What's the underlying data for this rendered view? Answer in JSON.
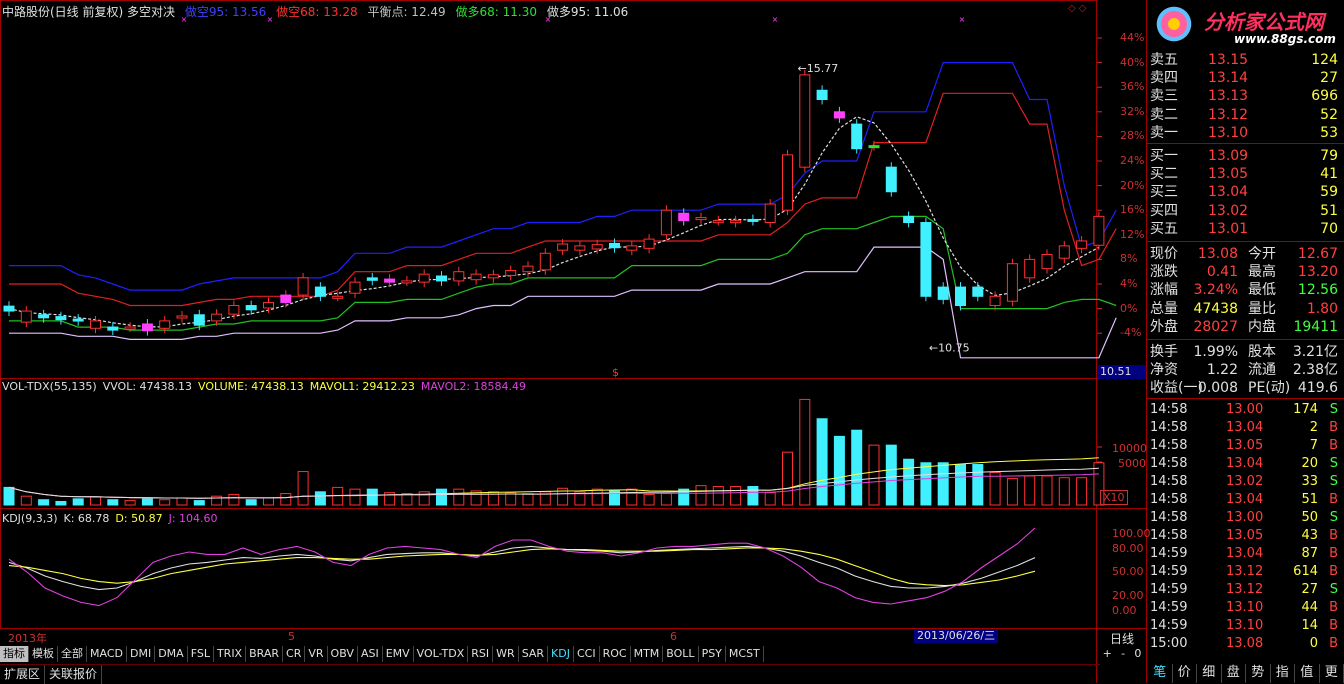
{
  "header": {
    "title": "中路股份(日线 前复权) 多空对决",
    "items": [
      {
        "label": "做空95: 13.56",
        "color": "#4040ff"
      },
      {
        "label": "做空68: 13.28",
        "color": "#ff3030"
      },
      {
        "label": "平衡点: 12.49",
        "color": "#c0c0c0"
      },
      {
        "label": "做多68: 11.30",
        "color": "#30e030"
      },
      {
        "label": "做多95: 11.06",
        "color": "#e0e0e0"
      }
    ]
  },
  "price_axis": [
    "44%",
    "40%",
    "36%",
    "32%",
    "28%",
    "24%",
    "20%",
    "16%",
    "12%",
    "8%",
    "4%",
    "0%",
    "-4%"
  ],
  "price_marker": "10.51",
  "annotations": {
    "high": "15.77",
    "low": "10.75",
    "sign": "$"
  },
  "volume_panel": {
    "title": "VOL-TDX(55,135)",
    "items": [
      {
        "label": "VVOL: 47438.13",
        "color": "#e0e0e0"
      },
      {
        "label": "VOLUME: 47438.13",
        "color": "#ffff40"
      },
      {
        "label": "MAVOL1: 29412.23",
        "color": "#ffff40"
      },
      {
        "label": "MAVOL2: 18584.49",
        "color": "#e040e0"
      }
    ],
    "axis": [
      "10000",
      "5000"
    ],
    "unit": "X10"
  },
  "kdj_panel": {
    "title": "KDJ(9,3,3)",
    "items": [
      {
        "label": "K: 68.78",
        "color": "#e0e0e0"
      },
      {
        "label": "D: 50.87",
        "color": "#ffff40"
      },
      {
        "label": "J: 104.60",
        "color": "#e040e0"
      }
    ],
    "axis": [
      "100.00",
      "80.00",
      "50.00",
      "20.00",
      "0.00"
    ]
  },
  "date_axis": {
    "year": "2013年",
    "m5": "5",
    "m6": "6",
    "cursor_date": "2013/06/26/三"
  },
  "period": "日线",
  "zoom": {
    "plus": "+",
    "minus": "-",
    "zero": "0"
  },
  "indicator_tabs": [
    "指标",
    "模板",
    "全部",
    "MACD",
    "DMI",
    "DMA",
    "FSL",
    "TRIX",
    "BRAR",
    "CR",
    "VR",
    "OBV",
    "ASI",
    "EMV",
    "VOL-TDX",
    "RSI",
    "WR",
    "SAR",
    "KDJ",
    "CCI",
    "ROC",
    "MTM",
    "BOLL",
    "PSY",
    "MCST"
  ],
  "status_tabs": [
    "扩展区",
    "关联报价"
  ],
  "logo": {
    "title": "分析家公式网",
    "url": "www.88gs.com"
  },
  "order_book": {
    "asks": [
      {
        "label": "卖五",
        "price": "13.15",
        "vol": "124"
      },
      {
        "label": "卖四",
        "price": "13.14",
        "vol": "27"
      },
      {
        "label": "卖三",
        "price": "13.13",
        "vol": "696"
      },
      {
        "label": "卖二",
        "price": "13.12",
        "vol": "52"
      },
      {
        "label": "卖一",
        "price": "13.10",
        "vol": "53"
      }
    ],
    "bids": [
      {
        "label": "买一",
        "price": "13.09",
        "vol": "79"
      },
      {
        "label": "买二",
        "price": "13.05",
        "vol": "41"
      },
      {
        "label": "买三",
        "price": "13.04",
        "vol": "59"
      },
      {
        "label": "买四",
        "price": "13.02",
        "vol": "51"
      },
      {
        "label": "买五",
        "price": "13.01",
        "vol": "70"
      }
    ]
  },
  "quote": [
    {
      "l1": "现价",
      "v1": "13.08",
      "c1": "#ff4040",
      "l2": "今开",
      "v2": "12.67",
      "c2": "#ff4040"
    },
    {
      "l1": "涨跌",
      "v1": "0.41",
      "c1": "#ff4040",
      "l2": "最高",
      "v2": "13.20",
      "c2": "#ff4040"
    },
    {
      "l1": "涨幅",
      "v1": "3.24%",
      "c1": "#ff4040",
      "l2": "最低",
      "v2": "12.56",
      "c2": "#40ff40"
    },
    {
      "l1": "总量",
      "v1": "47438",
      "c1": "#ffff40",
      "l2": "量比",
      "v2": "1.80",
      "c2": "#ff4040"
    },
    {
      "l1": "外盘",
      "v1": "28027",
      "c1": "#ff4040",
      "l2": "内盘",
      "v2": "19411",
      "c2": "#40ff40"
    }
  ],
  "stats": [
    {
      "l1": "换手",
      "v1": "1.99%",
      "l2": "股本",
      "v2": "3.21亿"
    },
    {
      "l1": "净资",
      "v1": "1.22",
      "l2": "流通",
      "v2": "2.38亿"
    },
    {
      "l1": "收益(一)",
      "v1": "0.008",
      "l2": "PE(动)",
      "v2": "419.6"
    }
  ],
  "ticks": [
    {
      "time": "14:58",
      "price": "13.00",
      "vol": "174",
      "side": "S"
    },
    {
      "time": "14:58",
      "price": "13.04",
      "vol": "2",
      "side": "B"
    },
    {
      "time": "14:58",
      "price": "13.05",
      "vol": "7",
      "side": "B"
    },
    {
      "time": "14:58",
      "price": "13.04",
      "vol": "20",
      "side": "S"
    },
    {
      "time": "14:58",
      "price": "13.02",
      "vol": "33",
      "side": "S"
    },
    {
      "time": "14:58",
      "price": "13.04",
      "vol": "51",
      "side": "B"
    },
    {
      "time": "14:58",
      "price": "13.00",
      "vol": "50",
      "side": "S"
    },
    {
      "time": "14:58",
      "price": "13.05",
      "vol": "43",
      "side": "B"
    },
    {
      "time": "14:59",
      "price": "13.04",
      "vol": "87",
      "side": "B"
    },
    {
      "time": "14:59",
      "price": "13.12",
      "vol": "614",
      "side": "B"
    },
    {
      "time": "14:59",
      "price": "13.12",
      "vol": "27",
      "side": "S"
    },
    {
      "time": "14:59",
      "price": "13.10",
      "vol": "44",
      "side": "B"
    },
    {
      "time": "14:59",
      "price": "13.10",
      "vol": "14",
      "side": "B"
    },
    {
      "time": "15:00",
      "price": "13.08",
      "vol": "0",
      "side": "B"
    }
  ],
  "bottom_tabs": [
    "笔",
    "价",
    "细",
    "盘",
    "势",
    "指",
    "值",
    "更"
  ],
  "chart_data": {
    "type": "candlestick",
    "candles": [
      {
        "o": 0.4,
        "c": -0.4
      },
      {
        "o": -2.2,
        "c": -0.4
      },
      {
        "o": -1.0,
        "c": -1.5
      },
      {
        "o": -1.3,
        "c": -1.8
      },
      {
        "o": -1.7,
        "c": -2.0
      },
      {
        "o": -3.2,
        "c": -2.0
      },
      {
        "o": -3.0,
        "c": -3.5
      },
      {
        "o": -3.0,
        "c": -3.0
      },
      {
        "o": -2.5,
        "c": -3.6
      },
      {
        "o": -3.2,
        "c": -2.0
      },
      {
        "o": -1.5,
        "c": -1.2
      },
      {
        "o": -1.0,
        "c": -2.7
      },
      {
        "o": -2.0,
        "c": -0.9
      },
      {
        "o": -0.9,
        "c": 0.5
      },
      {
        "o": 0.5,
        "c": -0.2
      },
      {
        "o": 0.1,
        "c": 1.0
      },
      {
        "o": 1.0,
        "c": 2.2
      },
      {
        "o": 2.2,
        "c": 5.0
      },
      {
        "o": 3.5,
        "c": 2.0
      },
      {
        "o": 2.0,
        "c": 2.0
      },
      {
        "o": 2.5,
        "c": 4.3
      },
      {
        "o": 5.0,
        "c": 4.6
      },
      {
        "o": 4.3,
        "c": 4.8
      },
      {
        "o": 4.5,
        "c": 4.5
      },
      {
        "o": 4.3,
        "c": 5.6
      },
      {
        "o": 5.3,
        "c": 4.5
      },
      {
        "o": 4.5,
        "c": 6.0
      },
      {
        "o": 4.7,
        "c": 5.6
      },
      {
        "o": 5.0,
        "c": 5.5
      },
      {
        "o": 5.4,
        "c": 6.2
      },
      {
        "o": 6.0,
        "c": 6.9
      },
      {
        "o": 6.3,
        "c": 9.0
      },
      {
        "o": 9.5,
        "c": 10.5
      },
      {
        "o": 9.5,
        "c": 10.2
      },
      {
        "o": 9.7,
        "c": 10.4
      },
      {
        "o": 10.6,
        "c": 9.9
      },
      {
        "o": 9.5,
        "c": 10.2
      },
      {
        "o": 9.8,
        "c": 11.3
      },
      {
        "o": 12.0,
        "c": 16.0
      },
      {
        "o": 15.5,
        "c": 14.3
      },
      {
        "o": 14.6,
        "c": 14.8
      },
      {
        "o": 14.3,
        "c": 14.3
      },
      {
        "o": 14.0,
        "c": 14.3
      },
      {
        "o": 14.5,
        "c": 14.3
      },
      {
        "o": 14.0,
        "c": 17.0
      },
      {
        "o": 16.0,
        "c": 25.0
      },
      {
        "o": 23.0,
        "c": 38.0
      },
      {
        "o": 35.5,
        "c": 34.0
      },
      {
        "o": 32.0,
        "c": 31.0
      },
      {
        "o": 30.0,
        "c": 26.0
      },
      {
        "o": 26.5,
        "c": 26.5
      },
      {
        "o": 23.0,
        "c": 19.0
      },
      {
        "o": 15.0,
        "c": 14.0
      },
      {
        "o": 14.0,
        "c": 2.0
      },
      {
        "o": 3.5,
        "c": 1.5
      },
      {
        "o": 3.5,
        "c": 0.5
      },
      {
        "o": 3.5,
        "c": 2.0
      },
      {
        "o": 0.5,
        "c": 2.0
      },
      {
        "o": 1.2,
        "c": 7.3
      },
      {
        "o": 5.0,
        "c": 8.0
      },
      {
        "o": 6.5,
        "c": 8.8
      },
      {
        "o": 8.2,
        "c": 10.2
      },
      {
        "o": 9.8,
        "c": 11.0
      },
      {
        "o": 10.3,
        "c": 15.0
      }
    ],
    "volumes": [
      2000,
      1000,
      600,
      400,
      700,
      900,
      600,
      500,
      700,
      600,
      800,
      500,
      1000,
      1200,
      600,
      800,
      1300,
      3800,
      1500,
      2000,
      1800,
      1800,
      1400,
      1300,
      1500,
      1800,
      1800,
      1600,
      1500,
      1400,
      1300,
      1500,
      1900,
      1500,
      1800,
      1600,
      1800,
      1200,
      1300,
      1800,
      2200,
      2100,
      2100,
      2100,
      1400,
      6000,
      12000,
      9800,
      7800,
      8500,
      6800,
      6800,
      5200,
      4800,
      4800,
      4600,
      4600,
      3700,
      3000,
      3300,
      3300,
      3100,
      3100,
      4800
    ],
    "lines": {
      "short95_pct": [
        7,
        7,
        7,
        7,
        5.5,
        5,
        4,
        3,
        3,
        3,
        3,
        4,
        4.5,
        5,
        5,
        5,
        5,
        5,
        5,
        6,
        9,
        9,
        9,
        10,
        10,
        10,
        11,
        12,
        13,
        13,
        14,
        14,
        14,
        14,
        15,
        15,
        16,
        16,
        16,
        16,
        16,
        17,
        17,
        17,
        17,
        18.5,
        22,
        24,
        24,
        24,
        32,
        32,
        32,
        32,
        40,
        40,
        40,
        40,
        40,
        34,
        34,
        20,
        10,
        11,
        16
      ],
      "short68_pct": [
        4,
        4,
        4,
        4,
        2.5,
        2,
        1.5,
        0.5,
        0.5,
        0.5,
        0.5,
        1,
        1.5,
        1.5,
        2,
        2,
        2,
        2,
        2,
        3,
        6,
        6,
        6,
        7,
        7,
        7,
        8,
        9,
        9,
        9,
        10,
        11,
        11,
        11,
        11,
        11,
        11,
        11,
        11,
        11,
        11,
        12,
        12,
        12,
        12,
        14,
        17,
        18,
        18,
        18,
        27,
        27,
        27,
        27,
        35,
        35,
        35,
        35,
        35,
        30,
        30,
        16,
        7,
        8,
        13
      ],
      "long68_pct": [
        -2,
        -2,
        -2,
        -2,
        -3,
        -3,
        -3,
        -3.5,
        -3.5,
        -3.5,
        -3.5,
        -3,
        -2.5,
        -2.5,
        -2,
        -2,
        -2,
        -2,
        -2,
        -1.5,
        1,
        1,
        1,
        1.5,
        1.5,
        1.5,
        2.5,
        3.5,
        4,
        4,
        5,
        5,
        5,
        5,
        5,
        5,
        7,
        7,
        7,
        7,
        7,
        8,
        8,
        8,
        8,
        9,
        12,
        13,
        13,
        13,
        14,
        15,
        15,
        15,
        13,
        0,
        0,
        0,
        0,
        0,
        0,
        1,
        1.5,
        1.5,
        0.5
      ],
      "long95_pct": [
        -4,
        -4,
        -4,
        -4,
        -4.5,
        -4.5,
        -4.5,
        -5,
        -5,
        -5,
        -5,
        -4.5,
        -4.5,
        -4,
        -4,
        -4,
        -4,
        -4,
        -4,
        -3.5,
        -2,
        -2,
        -2,
        -1.5,
        -1.5,
        -1.5,
        -1,
        0,
        0.5,
        0.5,
        2,
        2,
        2,
        2,
        2,
        2,
        3,
        3,
        3,
        3,
        3,
        4,
        4,
        4,
        4,
        5,
        6,
        6,
        6,
        6,
        10,
        10,
        10,
        10,
        8,
        -8,
        -8,
        -8,
        -8,
        -8,
        -8,
        -8,
        -8,
        -8,
        -1.5
      ]
    },
    "kdj": {
      "K": [
        62,
        55,
        45,
        38,
        32,
        28,
        30,
        38,
        48,
        55,
        60,
        62,
        65,
        68,
        67,
        70,
        72,
        70,
        66,
        64,
        68,
        72,
        73,
        74,
        74,
        72,
        70,
        75,
        80,
        82,
        80,
        78,
        77,
        76,
        74,
        75,
        77,
        78,
        79,
        80,
        81,
        82,
        80,
        76,
        70,
        62,
        55,
        45,
        38,
        32,
        30,
        30,
        32,
        36,
        42,
        50,
        58,
        68
      ],
      "D": [
        58,
        56,
        52,
        48,
        42,
        38,
        36,
        38,
        42,
        48,
        52,
        56,
        60,
        62,
        64,
        66,
        68,
        68,
        67,
        66,
        66,
        68,
        70,
        71,
        72,
        72,
        71,
        72,
        75,
        78,
        79,
        78,
        78,
        77,
        76,
        76,
        76,
        77,
        78,
        78,
        79,
        80,
        80,
        79,
        76,
        72,
        66,
        58,
        50,
        42,
        36,
        34,
        33,
        34,
        37,
        40,
        45,
        51
      ],
      "J": [
        66,
        50,
        30,
        20,
        12,
        8,
        18,
        40,
        62,
        70,
        75,
        72,
        72,
        80,
        72,
        78,
        82,
        75,
        62,
        58,
        72,
        80,
        82,
        80,
        78,
        72,
        68,
        82,
        90,
        90,
        82,
        76,
        74,
        74,
        70,
        74,
        80,
        82,
        82,
        84,
        86,
        86,
        80,
        70,
        56,
        38,
        30,
        18,
        12,
        10,
        14,
        18,
        26,
        38,
        55,
        70,
        85,
        105
      ]
    }
  }
}
